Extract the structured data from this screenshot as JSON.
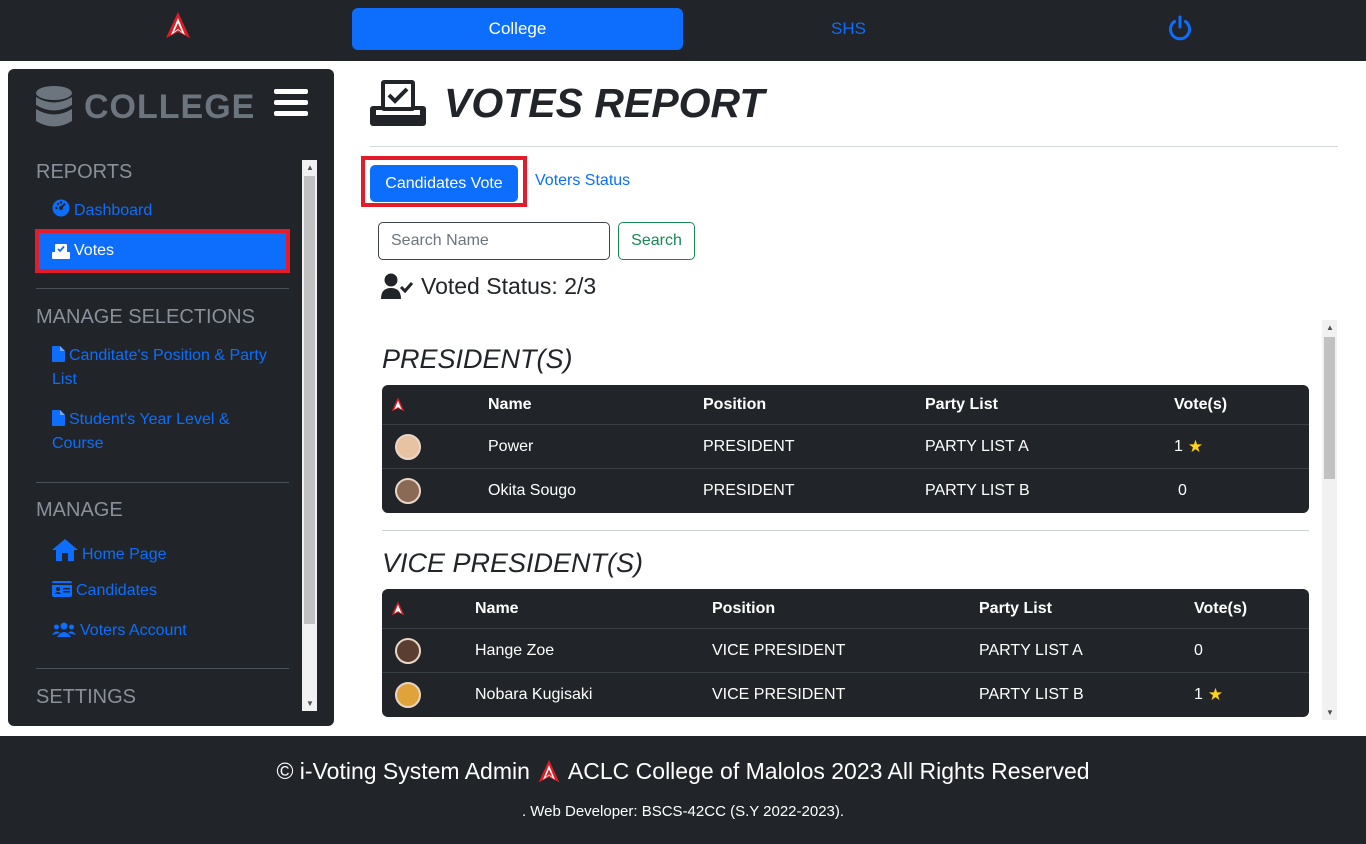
{
  "nav": {
    "college_label": "College",
    "shs_label": "SHS"
  },
  "sidebar": {
    "brand": "COLLEGE",
    "sections": {
      "reports": "REPORTS",
      "manage_selections": "MANAGE SELECTIONS",
      "manage": "MANAGE",
      "settings": "SETTINGS"
    },
    "items": {
      "dashboard": "Dashboard",
      "votes": "Votes",
      "position_party": "Canditate's Position & Party List",
      "year_course": "Student's Year Level & Course",
      "home_page": "Home Page",
      "candidates": "Candidates",
      "voters_account": "Voters Account"
    }
  },
  "main": {
    "title": "VOTES REPORT",
    "tabs": {
      "candidates_vote": "Candidates Vote",
      "voters_status": "Voters Status"
    },
    "search": {
      "placeholder": "Search Name",
      "button": "Search"
    },
    "voted_status": "Voted Status: 2/3",
    "table_headers": {
      "name": "Name",
      "position": "Position",
      "party": "Party List",
      "votes": "Vote(s)"
    },
    "sections": [
      {
        "title": "PRESIDENT(S)",
        "rows": [
          {
            "name": "Power",
            "position": "PRESIDENT",
            "party": "PARTY LIST A",
            "votes": "1",
            "star": true
          },
          {
            "name": "Okita Sougo",
            "position": "PRESIDENT",
            "party": "PARTY LIST B",
            "votes": "0",
            "star": false
          }
        ]
      },
      {
        "title": "VICE PRESIDENT(S)",
        "rows": [
          {
            "name": "Hange Zoe",
            "position": "VICE PRESIDENT",
            "party": "PARTY LIST A",
            "votes": "0",
            "star": false
          },
          {
            "name": "Nobara Kugisaki",
            "position": "VICE PRESIDENT",
            "party": "PARTY LIST B",
            "votes": "1",
            "star": true
          }
        ]
      }
    ]
  },
  "footer": {
    "copyright_prefix": "© i-Voting System Admin",
    "copyright_suffix": "ACLC College of Malolos 2023 All Rights Reserved",
    "developer": ". Web Developer: BSCS-42CC (S.Y 2022-2023)."
  },
  "colors": {
    "primary": "#0d6efd",
    "dark": "#212529",
    "highlight": "#e21c2a",
    "success": "#198754",
    "star": "#ffd11a"
  }
}
